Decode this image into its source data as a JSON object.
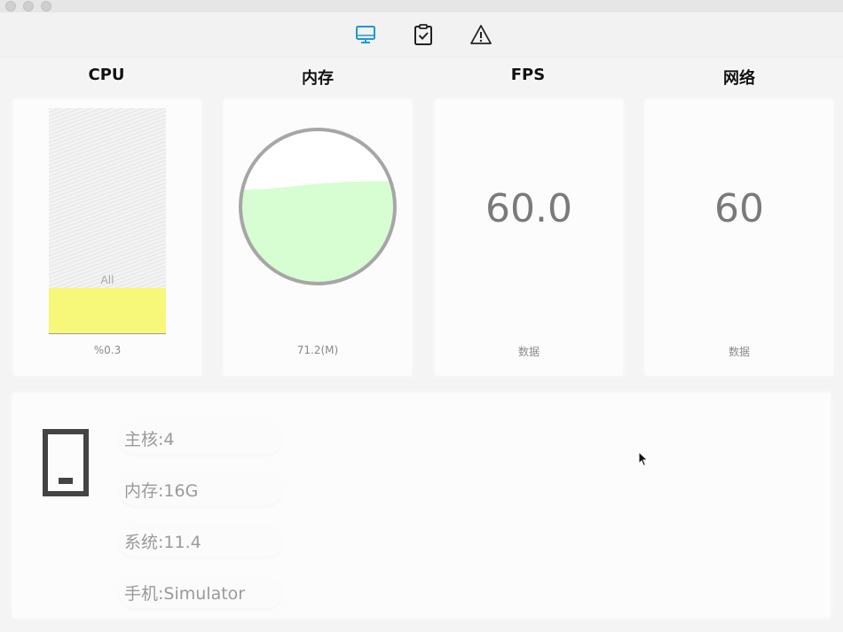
{
  "toolbar": {
    "tabs": [
      {
        "icon": "monitor-icon",
        "selected": true
      },
      {
        "icon": "clipboard-check-icon",
        "selected": false
      },
      {
        "icon": "warning-icon",
        "selected": false
      }
    ],
    "accent_color": "#1a9ad6"
  },
  "columns": {
    "cpu": {
      "title": "CPU",
      "bar_label": "All",
      "footer": "%0.3",
      "usage_fraction": 0.2,
      "fill_color": "#f7f77a"
    },
    "memory": {
      "title": "内存",
      "footer": "71.2(M)",
      "fill_fraction": 0.65,
      "fill_color": "#d7fdd3"
    },
    "fps": {
      "title": "FPS",
      "value": "60.0",
      "footer": "数据"
    },
    "network": {
      "title": "网络",
      "value": "60",
      "footer": "数据"
    }
  },
  "device": {
    "icon": "phone-icon",
    "info": [
      {
        "text": "主核:4"
      },
      {
        "text": "内存:16G"
      },
      {
        "text": "系统:11.4"
      },
      {
        "text": "手机:Simulator"
      }
    ]
  }
}
